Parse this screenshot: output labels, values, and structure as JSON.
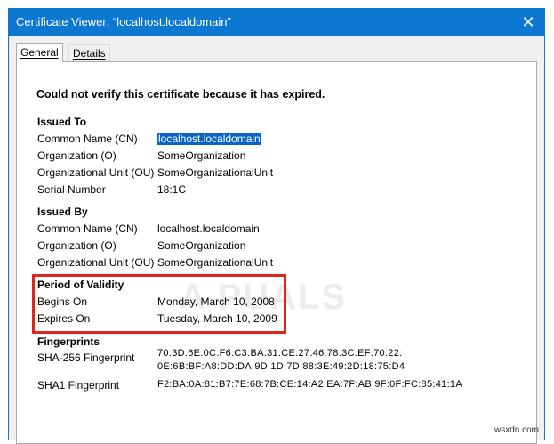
{
  "window": {
    "title": "Certificate Viewer: “localhost.localdomain”"
  },
  "tabs": [
    {
      "label": "General"
    },
    {
      "label": "Details"
    }
  ],
  "warning": "Could not verify this certificate because it has expired.",
  "issued_to": {
    "heading": "Issued To",
    "rows": [
      {
        "label": "Common Name (CN)",
        "value": "localhost.localdomain"
      },
      {
        "label": "Organization (O)",
        "value": "SomeOrganization"
      },
      {
        "label": "Organizational Unit (OU)",
        "value": "SomeOrganizationalUnit"
      },
      {
        "label": "Serial Number",
        "value": "18:1C"
      }
    ]
  },
  "issued_by": {
    "heading": "Issued By",
    "rows": [
      {
        "label": "Common Name (CN)",
        "value": "localhost.localdomain"
      },
      {
        "label": "Organization (O)",
        "value": "SomeOrganization"
      },
      {
        "label": "Organizational Unit (OU)",
        "value": "SomeOrganizationalUnit"
      }
    ]
  },
  "validity": {
    "heading": "Period of Validity",
    "rows": [
      {
        "label": "Begins On",
        "value": "Monday, March 10, 2008"
      },
      {
        "label": "Expires On",
        "value": "Tuesday, March 10, 2009"
      }
    ]
  },
  "fingerprints": {
    "heading": "Fingerprints",
    "sha256_label": "SHA-256 Fingerprint",
    "sha256_line1": "70:3D:6E:0C:F6:C3:BA:31:CE:27:46:78:3C:EF:70:22:",
    "sha256_line2": "0E:6B:BF:A8:DD:DA:9D:1D:7D:88:3E:49:2D:18:75:D4",
    "sha1_label": "SHA1 Fingerprint",
    "sha1_value": "F2:BA:0A:81:B7:7E:68:7B:CE:14:A2:EA:7F:AB:9F:0F:FC:85:41:1A"
  },
  "watermark": "A PUALS",
  "site": "wsxdn.com",
  "colors": {
    "titlebar": "#0d78d2",
    "selection": "#0a64c8",
    "highlight": "#e0231f"
  }
}
